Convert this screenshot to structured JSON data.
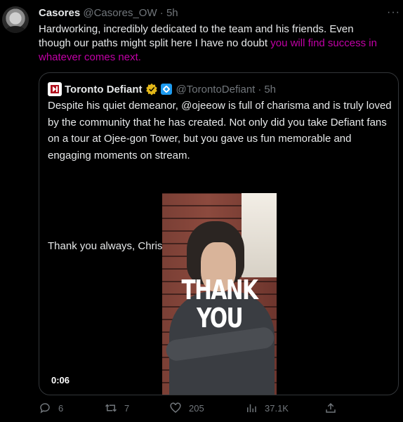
{
  "tweet": {
    "author_name": "Casores",
    "author_handle": "@Casores_OW",
    "time": "5h",
    "more_label": "···",
    "text_lines": [
      "Hardworking, incredibly dedicated to the team and his friends. Even",
      "though our paths might split here I have no doubt ",
      "you will find success in",
      "whatever comes next."
    ]
  },
  "quote": {
    "author_name": "Toronto Defiant",
    "author_handle": "@TorontoDefiant",
    "time": "5h",
    "text": "Despite his quiet demeanor, @ojeeow is full of charisma and is truly loved by the community that he has created. Not only did you take Defiant fans on a tour at Ojee-gon Tower, but you gave us fun memorable and engaging moments on stream.",
    "thanks": "Thank you always, Christian!",
    "video_overlay_text": "THANK YOU",
    "video_time": "0:06"
  },
  "actions": {
    "replies": "6",
    "retweets": "7",
    "likes": "205",
    "views": "37.1K"
  },
  "colors": {
    "accent_link": "#c200a6",
    "muted": "#71767b",
    "border": "#333639"
  }
}
